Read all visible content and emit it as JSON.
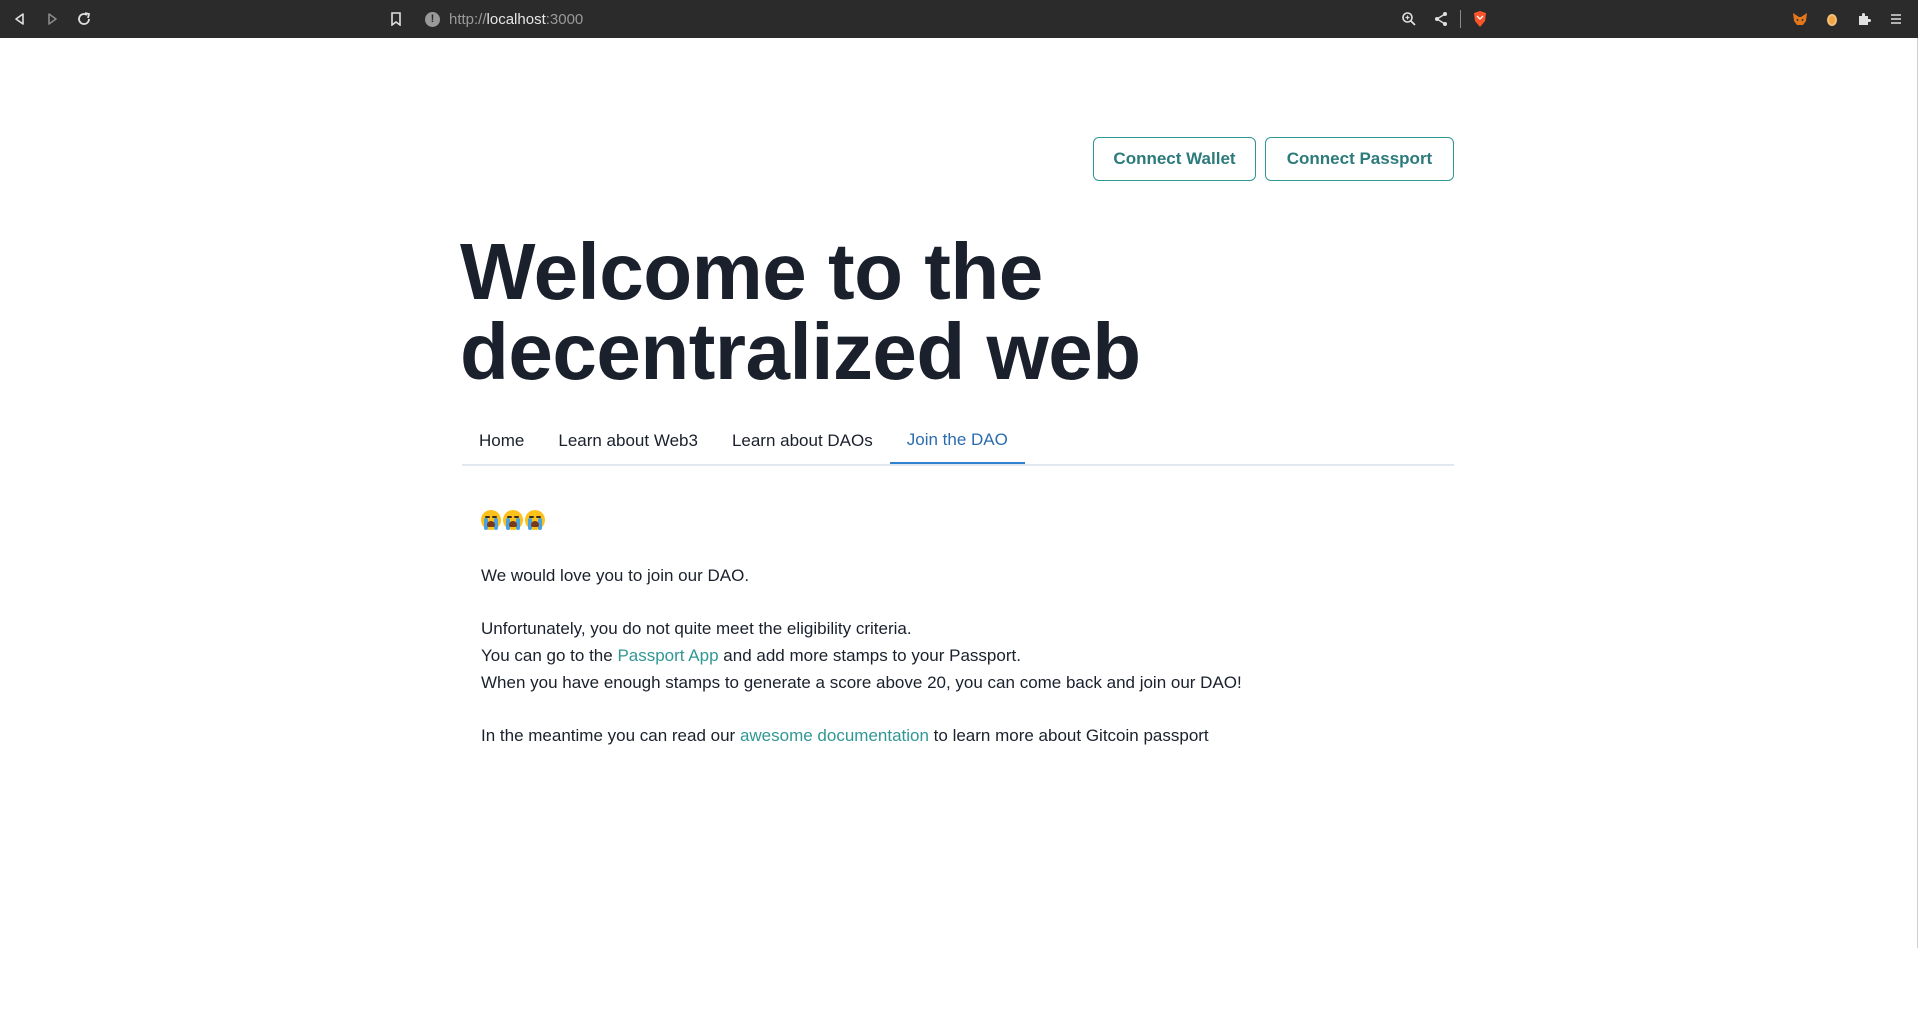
{
  "browser": {
    "url_scheme": "http://",
    "url_host": "localhost",
    "url_port": ":3000",
    "back_icon": "back-arrow-icon",
    "forward_icon": "forward-arrow-icon",
    "reload_icon": "reload-icon",
    "bookmark_icon": "bookmark-icon",
    "zoom_icon": "zoom-icon",
    "share_icon": "share-icon",
    "brave_icon": "brave-shield-icon",
    "menu_icon": "hamburger-menu-icon"
  },
  "header": {
    "connect_wallet": "Connect Wallet",
    "connect_passport": "Connect Passport"
  },
  "hero": {
    "line1": "Welcome to the",
    "line2": "decentralized web"
  },
  "tabs": [
    {
      "label": "Home"
    },
    {
      "label": "Learn about Web3"
    },
    {
      "label": "Learn about DAOs"
    },
    {
      "label": "Join the DAO"
    }
  ],
  "content": {
    "emoji_count_label": "😭😭😭",
    "intro": "We would love you to join our DAO.",
    "line1": "Unfortunately, you do not quite meet the eligibility criteria.",
    "line2_before": "You can go to the ",
    "line2_link": "Passport App",
    "line2_after": " and add more stamps to your Passport.",
    "line3": "When you have enough stamps to generate a score above 20, you can come back and join our DAO!",
    "line4_before": "In the meantime you can read our ",
    "line4_link": "awesome documentation",
    "line4_after": " to learn more about Gitcoin passport"
  },
  "colors": {
    "accent": "#319795",
    "active_tab": "#3182ce",
    "heading": "#1a202c"
  }
}
